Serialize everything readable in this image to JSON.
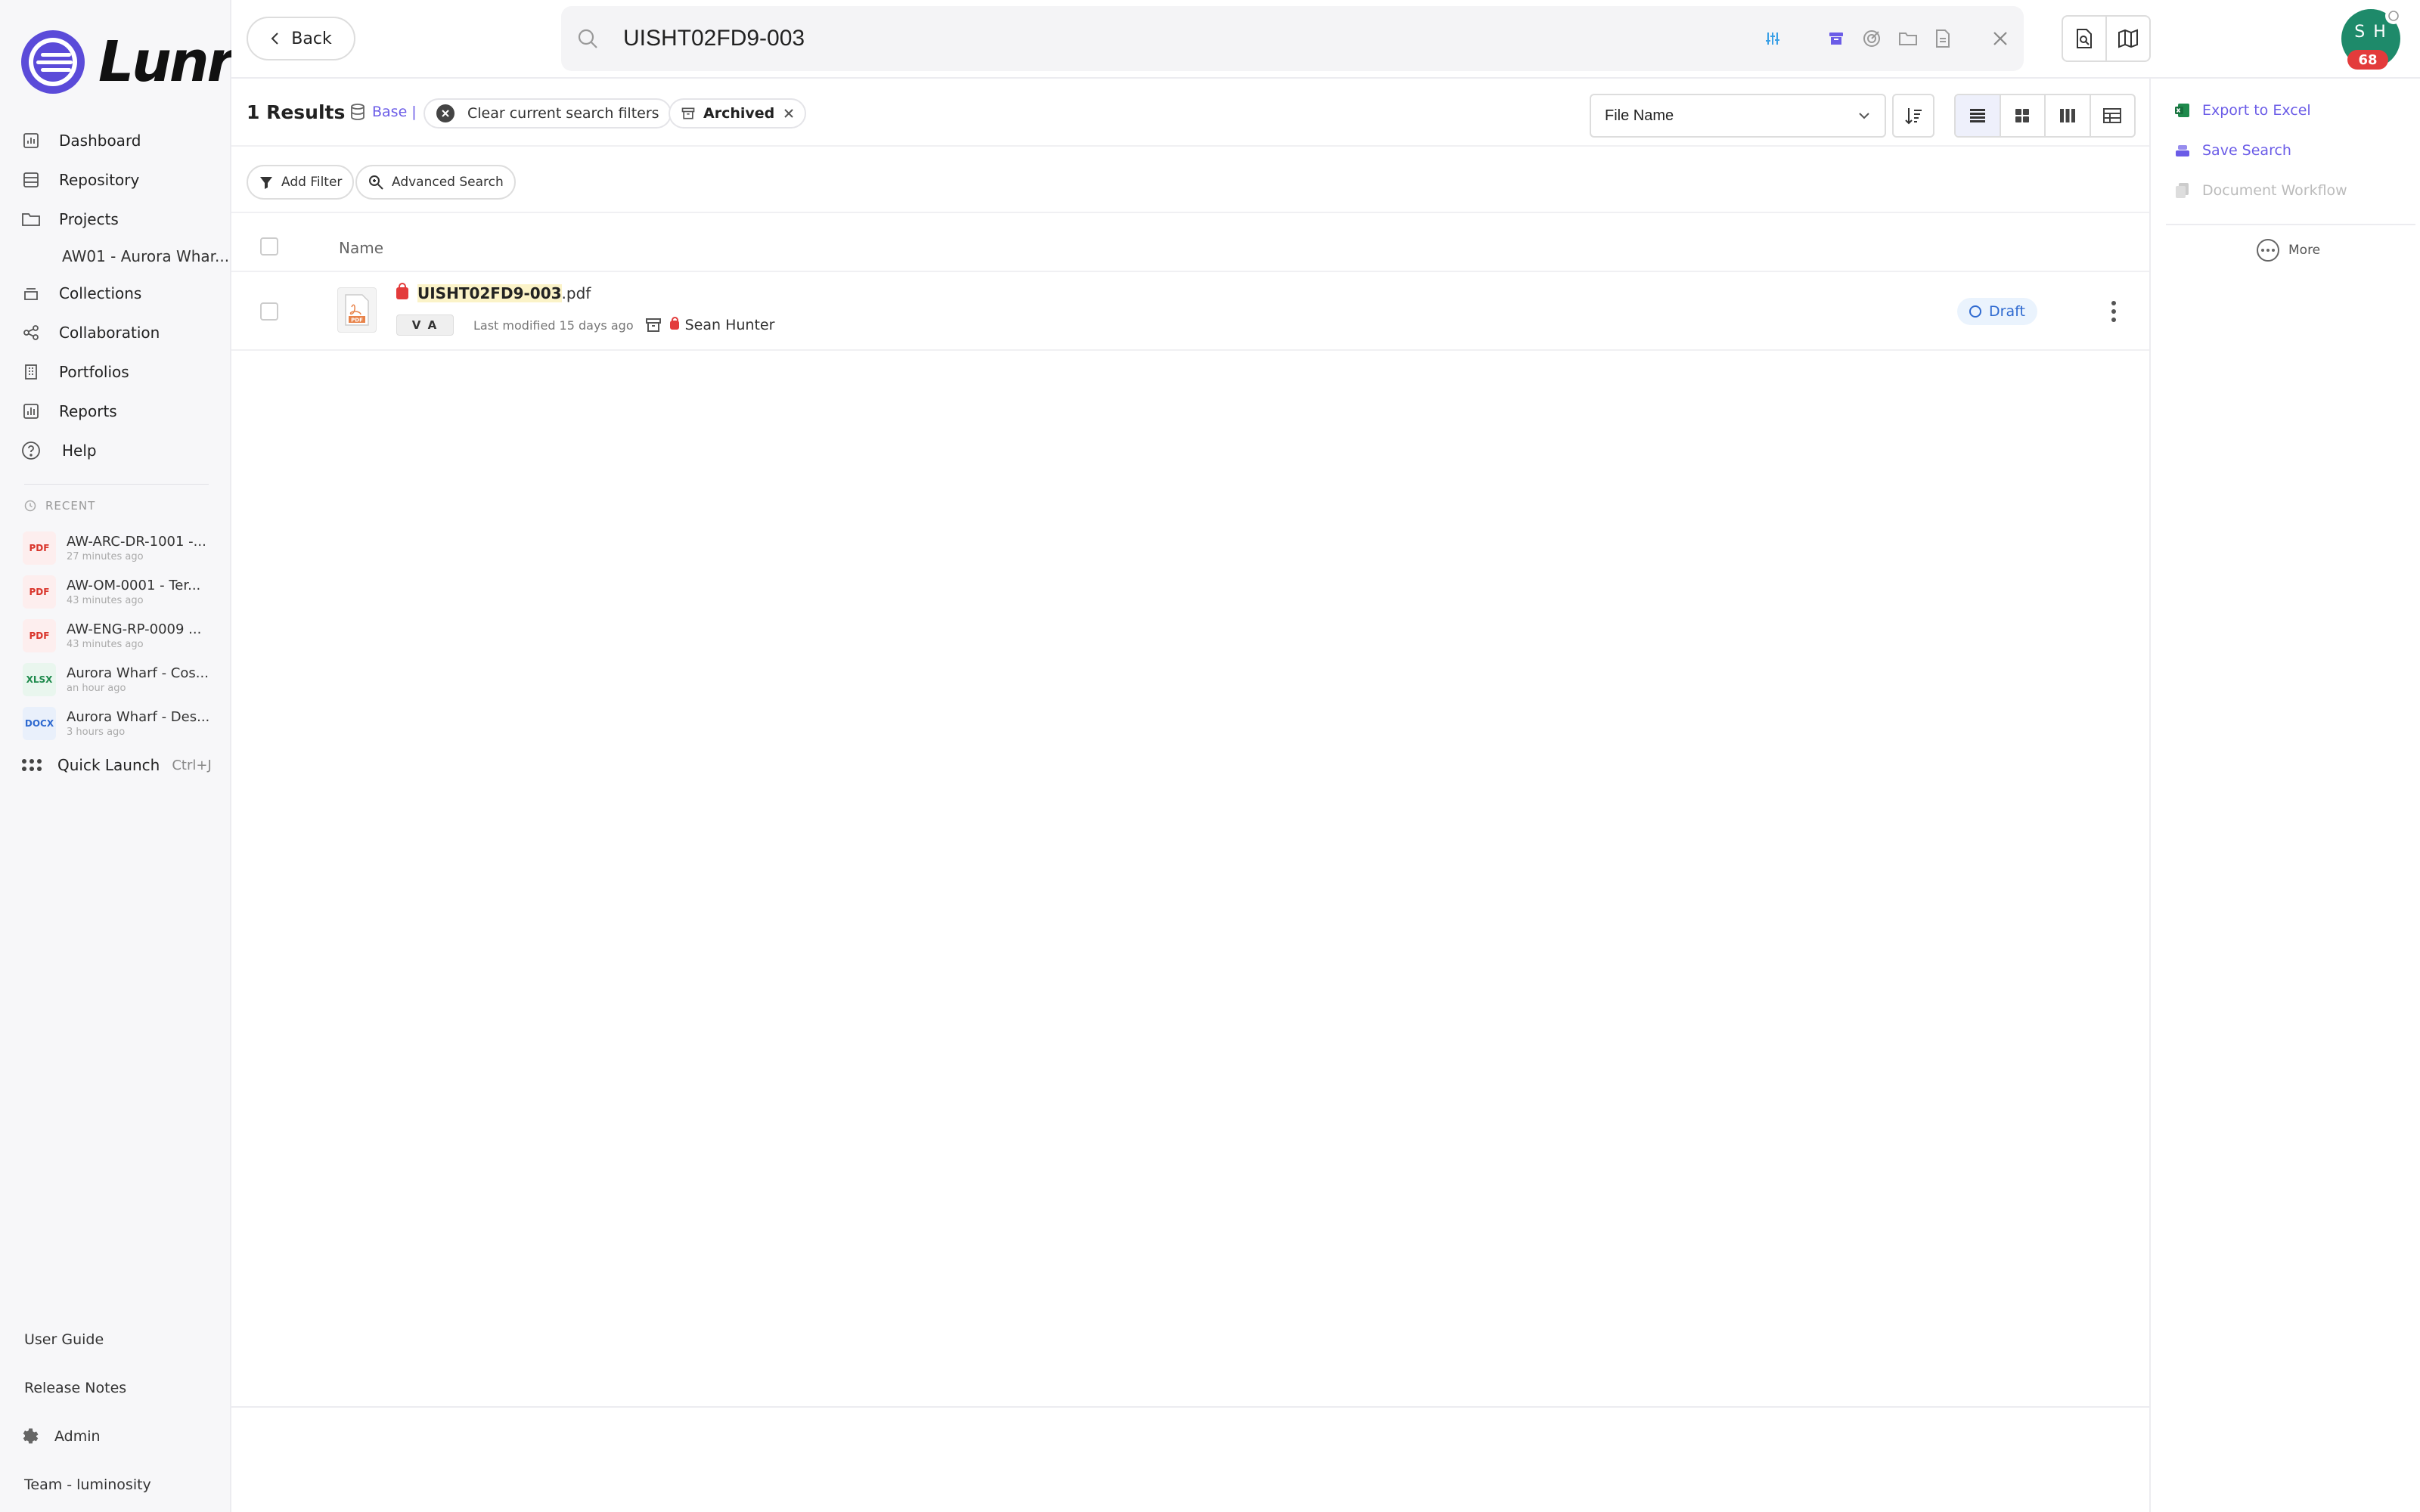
{
  "app": {
    "name": "Lunr"
  },
  "sidebar": {
    "nav": [
      {
        "label": "Dashboard",
        "icon": "dashboard-icon"
      },
      {
        "label": "Repository",
        "icon": "repository-icon"
      },
      {
        "label": "Projects",
        "icon": "folder-icon"
      },
      {
        "label": "Collections",
        "icon": "collections-icon"
      },
      {
        "label": "Collaboration",
        "icon": "share-icon"
      },
      {
        "label": "Portfolios",
        "icon": "building-icon"
      },
      {
        "label": "Reports",
        "icon": "chart-icon"
      },
      {
        "label": "Help",
        "icon": "help-icon"
      }
    ],
    "project_sub": "AW01 - Aurora Whar...",
    "recent_heading": "RECENT",
    "recent": [
      {
        "type": "PDF",
        "name": "AW-ARC-DR-1001 -...",
        "time": "27 minutes ago"
      },
      {
        "type": "PDF",
        "name": "AW-OM-0001 - Ter...",
        "time": "43 minutes ago"
      },
      {
        "type": "PDF",
        "name": "AW-ENG-RP-0009 ...",
        "time": "43 minutes ago"
      },
      {
        "type": "XLSX",
        "name": "Aurora Wharf - Cos...",
        "time": "an hour ago"
      },
      {
        "type": "DOCX",
        "name": "Aurora Wharf - Des...",
        "time": "3 hours ago"
      }
    ],
    "quick_launch": {
      "label": "Quick Launch",
      "shortcut": "Ctrl+J"
    },
    "bottom": {
      "user_guide": "User Guide",
      "release_notes": "Release Notes",
      "admin": "Admin",
      "team": "Team - luminosity"
    }
  },
  "topbar": {
    "back_label": "Back",
    "search_value": "UISHT02FD9-003",
    "avatar_initials": "S H",
    "avatar_badge": "68"
  },
  "results": {
    "count_label": "1 Results",
    "base_label": "Base",
    "base_sep": "|",
    "clear_filters_label": "Clear current search filters",
    "archived_label": "Archived",
    "sort_field": "File Name",
    "add_filter_label": "Add Filter",
    "advanced_search_label": "Advanced Search",
    "column_name": "Name",
    "rows": [
      {
        "name_match": "UISHT02FD9-003",
        "name_ext": ".pdf",
        "version": "V A",
        "modified": "Last modified 15 days ago",
        "owner": "Sean Hunter",
        "status": "Draft",
        "thumb_label": "PDF"
      }
    ]
  },
  "rightpanel": {
    "export_excel": "Export to Excel",
    "save_search": "Save Search",
    "document_workflow": "Document Workflow",
    "more": "More"
  },
  "colors": {
    "accent": "#6b5ce7",
    "status_draft": "#2f6ad0",
    "avatar_bg": "#1e8a6a",
    "badge": "#e33b3b"
  }
}
